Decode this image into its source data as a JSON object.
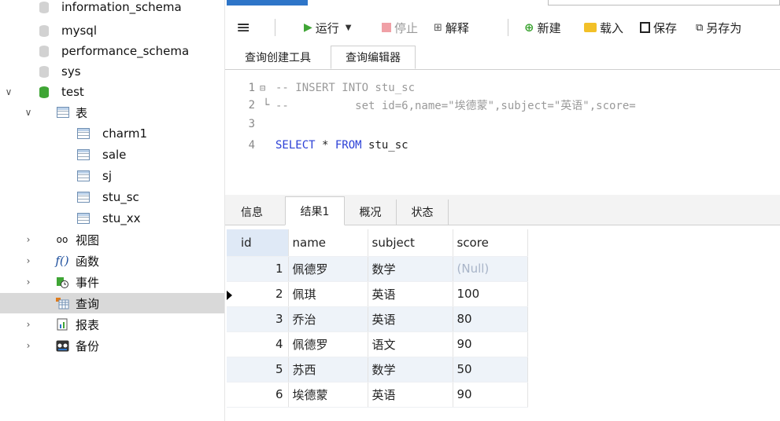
{
  "sidebar": {
    "databases": [
      "information_schema",
      "mysql",
      "performance_schema",
      "sys"
    ],
    "active_db": "test",
    "tables_group": "表",
    "tables": [
      "charm1",
      "sale",
      "sj",
      "stu_sc",
      "stu_xx"
    ],
    "groups": [
      "视图",
      "函数",
      "事件",
      "查询",
      "报表",
      "备份"
    ]
  },
  "toolbar": {
    "run": "运行",
    "stop": "停止",
    "explain": "解释",
    "new": "新建",
    "load": "载入",
    "save": "保存",
    "save_as": "另存为"
  },
  "tabs": [
    "查询创建工具",
    "查询编辑器"
  ],
  "editor": {
    "lines": [
      {
        "num": "1",
        "text": "-- INSERT INTO stu_sc"
      },
      {
        "num": "2",
        "text": "--          set id=6,name=\"埃德蒙\",subject=\"英语\",score="
      },
      {
        "num": "3",
        "text": ""
      },
      {
        "num": "4",
        "kw1": "SELECT",
        "mid": " * ",
        "kw2": "FROM",
        "rest": " stu_sc"
      }
    ]
  },
  "result_tabs": [
    "信息",
    "结果1",
    "概况",
    "状态"
  ],
  "results": {
    "columns": [
      "id",
      "name",
      "subject",
      "score"
    ],
    "rows": [
      [
        "1",
        "佩德罗",
        "数学",
        "(Null)"
      ],
      [
        "2",
        "佩琪",
        "英语",
        "100"
      ],
      [
        "3",
        "乔治",
        "英语",
        "80"
      ],
      [
        "4",
        "佩德罗",
        "语文",
        "90"
      ],
      [
        "5",
        "苏西",
        "数学",
        "50"
      ],
      [
        "6",
        "埃德蒙",
        "英语",
        "90"
      ]
    ]
  }
}
